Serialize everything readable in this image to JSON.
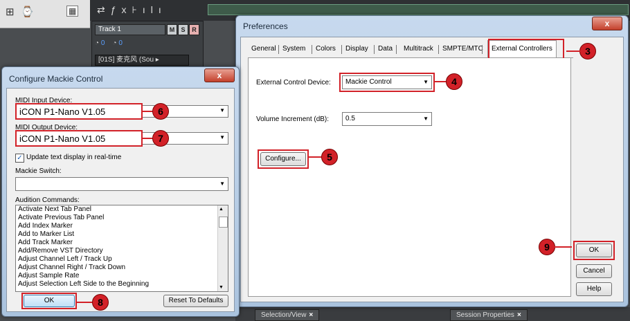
{
  "daw": {
    "track": {
      "name": "Track 1",
      "m_label": "M",
      "s_label": "S",
      "r_label": "R",
      "volume_value": "0",
      "pan_value": "0",
      "input_label": "[01S] 麦克风 (Sou ▸"
    },
    "toolbar_icons": [
      "fx-icon",
      "split-icon",
      "meter-icon"
    ],
    "bottom_tabs": [
      {
        "label": "Selection/View",
        "close": "×"
      },
      {
        "label": "Session Properties",
        "close": "×"
      }
    ]
  },
  "preferences": {
    "title": "Preferences",
    "close": "x",
    "tabs": [
      "General",
      "System",
      "Colors",
      "Display",
      "Data",
      "Multitrack",
      "SMPTE/MTC",
      "External Controllers"
    ],
    "active_tab": "External Controllers",
    "device_label": "External Control Device:",
    "device_value": "Mackie Control",
    "volume_label": "Volume Increment (dB):",
    "volume_value": "0.5",
    "configure_button": "Configure...",
    "ok_button": "OK",
    "cancel_button": "Cancel",
    "help_button": "Help"
  },
  "mackie": {
    "title": "Configure Mackie Control",
    "close": "x",
    "midi_input_label": "MIDI Input Device:",
    "midi_input_value": "iCON P1-Nano V1.05",
    "midi_output_label": "MIDI Output Device:",
    "midi_output_value": "iCON P1-Nano V1.05",
    "update_checkbox_label": "Update text display in real-time",
    "update_checked": true,
    "switch_label": "Mackie Switch:",
    "switch_value": "",
    "audition_label": "Audition Commands:",
    "commands": [
      "Activate Next Tab Panel",
      "Activate Previous Tab Panel",
      "Add Index Marker",
      "Add to Marker List",
      "Add Track Marker",
      "Add/Remove VST Directory",
      "Adjust Channel Left / Track Up",
      "Adjust Channel Right / Track Down",
      "Adjust Sample Rate",
      "Adjust Selection Left Side to the Beginning"
    ],
    "ok_button": "OK",
    "reset_button": "Reset To Defaults"
  },
  "callouts": [
    "3",
    "4",
    "5",
    "6",
    "7",
    "8",
    "9"
  ],
  "colors": {
    "highlight": "#d22128",
    "title_bar": "#b9cfe6"
  }
}
